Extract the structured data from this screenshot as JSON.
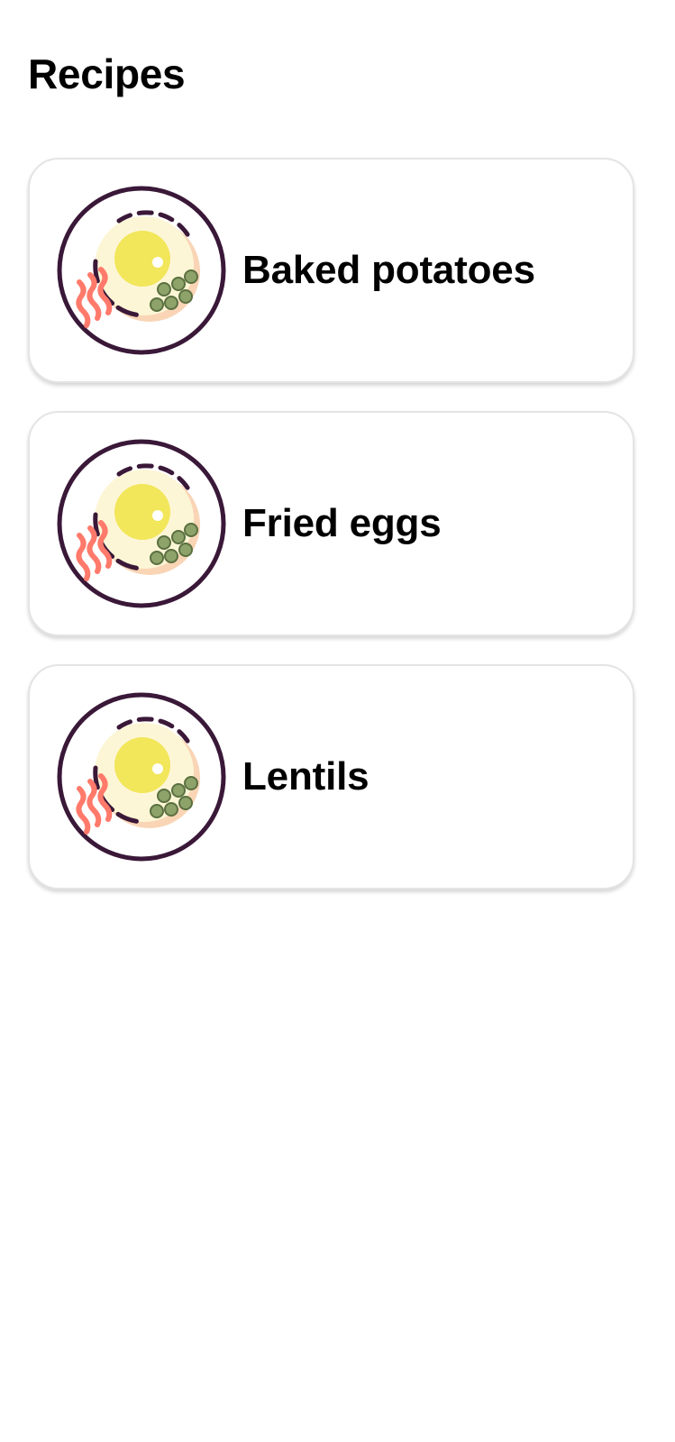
{
  "header": {
    "title": "Recipes"
  },
  "recipes": [
    {
      "name": "Baked potatoes",
      "icon": "breakfast-plate-icon"
    },
    {
      "name": "Fried eggs",
      "icon": "breakfast-plate-icon"
    },
    {
      "name": "Lentils",
      "icon": "breakfast-plate-icon"
    }
  ],
  "colors": {
    "plate_outline": "#3a1838",
    "egg_white": "#fdf6d6",
    "yolk": "#f2e65a",
    "bacon": "#ff7a6b",
    "peas": "#8ea36a",
    "plate_shadow": "#f4b27a"
  }
}
